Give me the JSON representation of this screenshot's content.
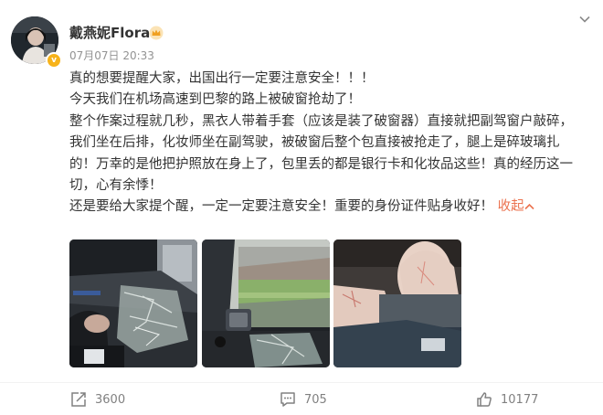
{
  "post": {
    "author": "戴燕妮Flora",
    "timestamp": "07月07日 20:33",
    "paragraphs": [
      "真的想要提醒大家，出国出行一定要注意安全！！！",
      "今天我们在机场高速到巴黎的路上被破窗抢劫了！",
      "整个作案过程就几秒，黑衣人带着手套（应该是装了破窗器）直接就把副驾窗户敲碎，我们坐在后排，化妆师坐在副驾驶，被破窗后整个包直接被抢走了，腿上是碎玻璃扎的！万幸的是他把护照放在身上了，包里丢的都是银行卡和化妆品这些！真的经历这一切，心有余悸！",
      "还是要给大家提个醒，一定一定要注意安全！重要的身份证件贴身收好！"
    ],
    "collapse_label": "收起"
  },
  "actions": {
    "repost_count": "3600",
    "comment_count": "705",
    "like_count": "10177"
  },
  "icons": {
    "verified": "verified-badge-icon",
    "crown": "crown-icon",
    "more": "chevron-down-icon",
    "repost": "repost-icon",
    "comment": "comment-icon",
    "like": "thumbs-up-icon"
  },
  "colors": {
    "collapse_link": "#eb7350",
    "meta_text": "#939393",
    "verified_badge": "#f7b31a"
  }
}
